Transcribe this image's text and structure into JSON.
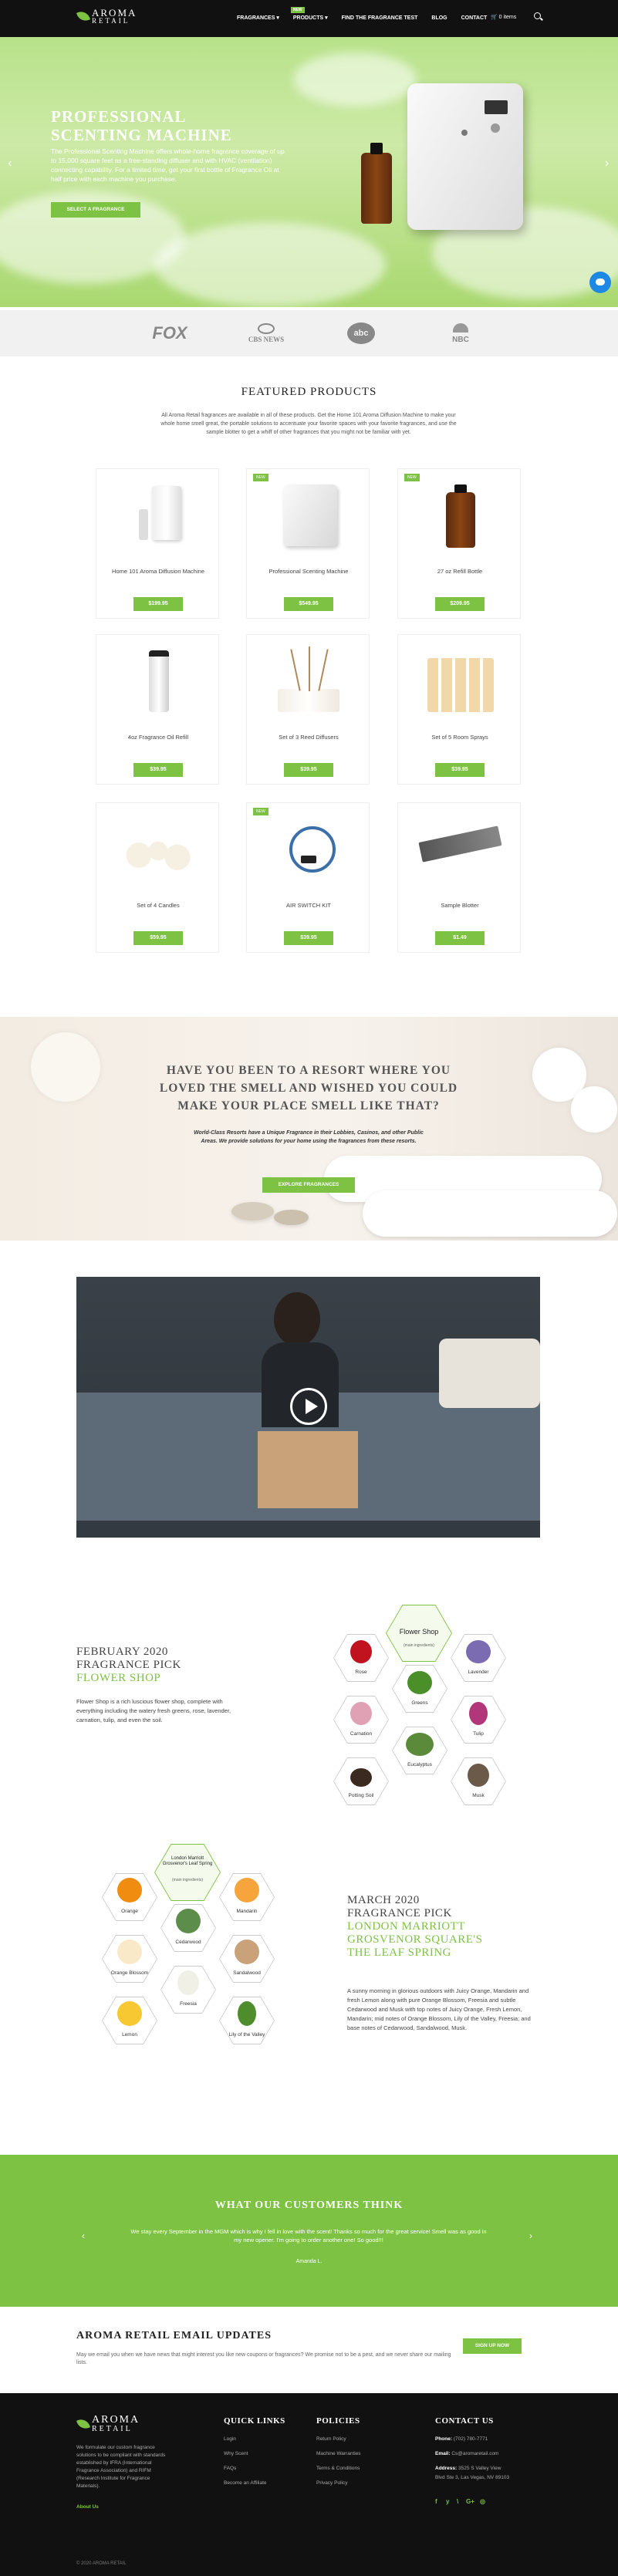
{
  "brand": {
    "name_top": "AROMA",
    "name_bottom": "RETAIL",
    "accent": "#7dc242"
  },
  "nav": {
    "items": [
      "FRAGRANCES",
      "PRODUCTS",
      "FIND THE FRAGRANCE TEST",
      "BLOG",
      "CONTACT"
    ],
    "new_badge": "NEW",
    "cart": "0 items"
  },
  "hero": {
    "title_line1": "PROFESSIONAL",
    "title_line2": "SCENTING MACHINE",
    "text": "The Professional Scenting Machine offers whole-home fragrance coverage of up to 15,000 square feet as a free-standing diffuser and with HVAC (ventilation) connecting capability. For a limited time, get your first bottle of Fragrance Oil at half price with each machine you purchase.",
    "button": "SELECT A FRAGRANCE",
    "prev": "‹",
    "next": "›"
  },
  "press_logos": [
    "FOX",
    "CBS NEWS",
    "abc",
    "NBC"
  ],
  "featured": {
    "title": "FEATURED PRODUCTS",
    "description": "All Aroma Retail fragrances are available in all of these products. Get the Home 101 Aroma Diffusion Machine to make your whole home smell great, the portable solutions to accentuate your favorite spaces with your favorite fragrances, and use the sample blotter to get a whiff of other fragrances that you might not be familiar with yet.",
    "products": [
      {
        "name": "Home 101 Aroma Diffusion Machine",
        "price": "$199.95",
        "new": false
      },
      {
        "name": "Professional Scenting Machine",
        "price": "$549.95",
        "new": true
      },
      {
        "name": "27 oz Refill Bottle",
        "price": "$209.95",
        "new": true
      },
      {
        "name": "4oz Fragrance Oil Refill",
        "price": "$39.95",
        "new": false
      },
      {
        "name": "Set of 3 Reed Diffusers",
        "price": "$39.95",
        "new": false
      },
      {
        "name": "Set of 5 Room Sprays",
        "price": "$39.95",
        "new": false
      },
      {
        "name": "Set of 4 Candles",
        "price": "$59.95",
        "new": false
      },
      {
        "name": "AIR SWITCH KIT",
        "price": "$39.95",
        "new": true
      },
      {
        "name": "Sample Blotter",
        "price": "$1.49",
        "new": false
      }
    ],
    "new_badge": "NEW"
  },
  "resort": {
    "heading": "HAVE YOU BEEN TO A RESORT WHERE YOU LOVED THE SMELL AND WISHED YOU COULD MAKE YOUR PLACE SMELL LIKE THAT?",
    "text": "World-Class Resorts have a Unique Fragrance in their Lobbies, Casinos, and other Public Areas. We provide solutions for your home using the fragrances from these resorts.",
    "button": "EXPLORE FRAGRANCES"
  },
  "feb_pick": {
    "line1": "FEBRUARY 2020",
    "line2": "FRAGRANCE PICK",
    "line3": "FLOWER SHOP",
    "text": "Flower Shop is a rich luscious flower shop, complete with everything including the watery fresh greens, rose, lavender, carnation, tulip, and even the soil.",
    "center_title": "Flower Shop",
    "center_sub": "(main ingredients)",
    "notes": [
      "Rose",
      "Lavender",
      "Greens",
      "Carnation",
      "Tulip",
      "Eucalyptus",
      "Potting Soil",
      "Musk"
    ]
  },
  "mar_pick": {
    "line1": "MARCH 2020",
    "line2": "FRAGRANCE PICK",
    "line3": "LONDON MARRIOTT",
    "line4": "GROSVENOR SQUARE'S",
    "line5": "THE LEAF SPRING",
    "text": "A sunny morning in glorious outdoors with Juicy Orange, Mandarin and fresh Lemon along with pure Orange Blossom, Freesia and subtle Cedarwood and Musk with top notes of Juicy Orange, Fresh Lemon, Mandarin; mid notes of Orange Blossom, Lily of the Valley, Freesia; and base notes of Cedarwood, Sandalwood, Musk.",
    "center_title": "London Marriott Grosvenor's Leaf Spring",
    "center_sub": "(main ingredients)",
    "notes": [
      "Orange",
      "Mandarin",
      "Cedarwood",
      "Orange Blossom",
      "Sandalwood",
      "Freesia",
      "Lemon",
      "Lily of the Valley"
    ]
  },
  "customers": {
    "title": "WHAT OUR CUSTOMERS THINK",
    "quote": "We stay every September in the MGM which is why I fell in love with the scent! Thanks so much for the great service! Smell was as good in my new opener. I'm going to order another one! So good!!!",
    "author": "Amanda L.",
    "prev": "‹",
    "next": "›"
  },
  "email": {
    "title": "AROMA RETAIL EMAIL UPDATES",
    "text": "May we email you when we have news that might interest you like new coupons or fragrances? We promise not to be a pest, and we never share our mailing lists.",
    "button": "SIGN UP NOW"
  },
  "footer": {
    "about": "We formulate our custom fragrance solutions to be compliant with standards established by IFRA (International Fragrance Association) and RIFM (Research Institute for Fragrance Materials).",
    "about_link": "About Us",
    "quick_title": "QUICK LINKS",
    "quick": [
      "Login",
      "Why Scent",
      "FAQs",
      "Become an Affiliate"
    ],
    "policies_title": "POLICIES",
    "policies": [
      "Return Policy",
      "Machine Warranties",
      "Terms & Conditions",
      "Privacy Policy"
    ],
    "contact_title": "CONTACT US",
    "phone_label": "Phone:",
    "phone": "(702) 780-7771",
    "email_label": "Email:",
    "email": "Cs@aromaretail.com",
    "address_label": "Address:",
    "address1": "3525 S Valley View",
    "address2": "Blvd Ste 3, Las Vegas, NV 89103",
    "social": [
      "f",
      "y",
      "\\",
      "G+",
      "◎"
    ],
    "copyright": "© 2020 AROMA RETAIL"
  }
}
